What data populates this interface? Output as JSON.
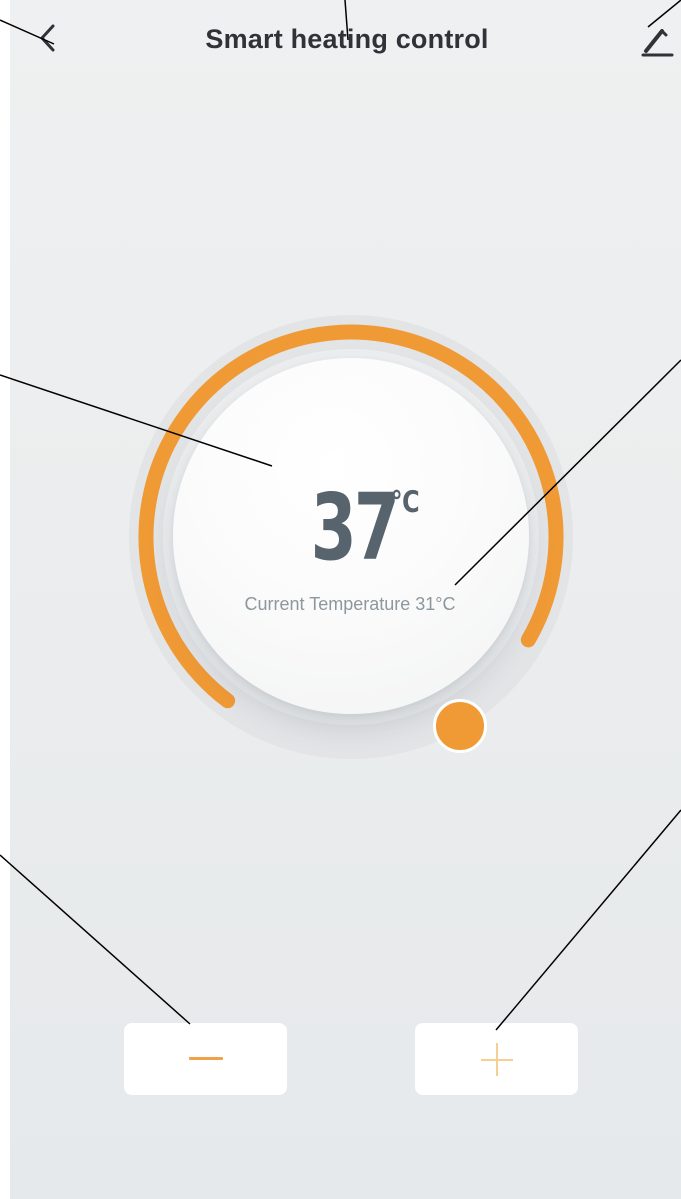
{
  "header": {
    "title": "Smart heating control",
    "back_icon": "chevron-left-icon",
    "edit_icon": "pencil-icon"
  },
  "thermostat": {
    "set_temperature": "37",
    "unit": "℃",
    "current_temperature_label": "Current Temperature 31°C",
    "dial_fill_fraction": 0.92,
    "accent_color": "#f09a36"
  },
  "controls": {
    "decrease_icon": "minus-icon",
    "increase_icon": "plus-icon"
  }
}
